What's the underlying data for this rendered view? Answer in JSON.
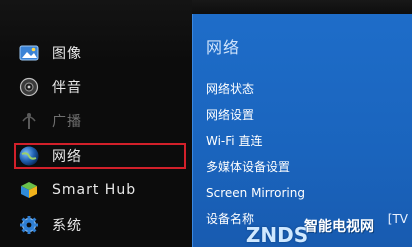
{
  "menu": {
    "items": [
      {
        "label": "图像",
        "icon": "picture-icon"
      },
      {
        "label": "伴音",
        "icon": "sound-icon"
      },
      {
        "label": "广播",
        "icon": "broadcast-icon"
      },
      {
        "label": "网络",
        "icon": "globe-icon"
      },
      {
        "label": "Smart Hub",
        "icon": "smart-hub-icon"
      },
      {
        "label": "系统",
        "icon": "gear-icon"
      }
    ],
    "selected": "网络"
  },
  "panel": {
    "title": "网络",
    "items": [
      "网络状态",
      "网络设置",
      "Wi-Fi 直连",
      "多媒体设备设置",
      "Screen Mirroring",
      "设备名称"
    ],
    "device_name_value": "[TV"
  },
  "watermark": {
    "text": "智能电视网",
    "logo": "ZNDS"
  },
  "colors": {
    "panel_blue": "#1e6dc9",
    "selection_red": "#d2202a"
  }
}
